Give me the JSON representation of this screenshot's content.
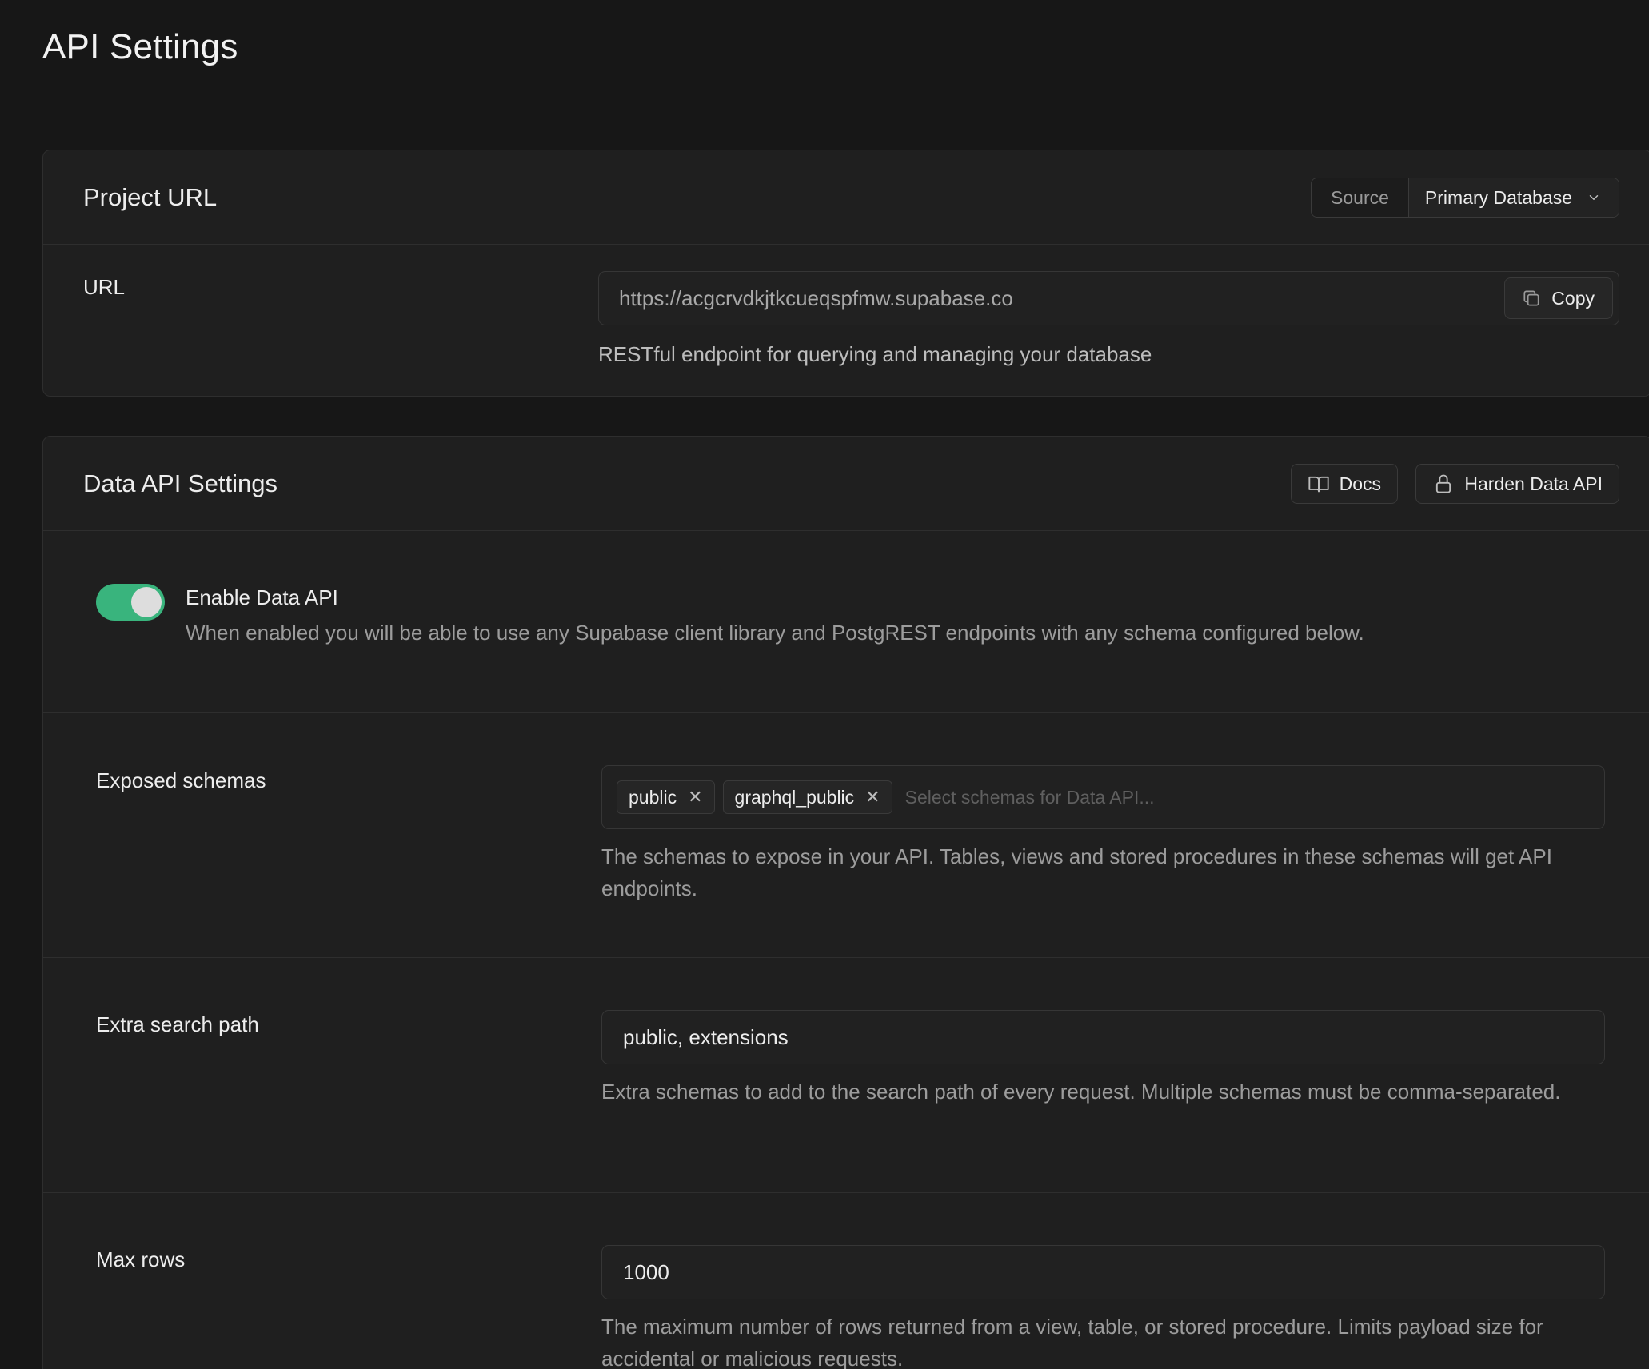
{
  "page": {
    "title": "API Settings"
  },
  "project_url": {
    "title": "Project URL",
    "source_label": "Source",
    "source_value": "Primary Database",
    "url_label": "URL",
    "url_value": "https://acgcrvdkjtkcueqspfmw.supabase.co",
    "copy_label": "Copy",
    "url_description": "RESTful endpoint for querying and managing your database"
  },
  "data_api": {
    "title": "Data API Settings",
    "docs_label": "Docs",
    "harden_label": "Harden Data API",
    "enable_label": "Enable Data API",
    "enable_description": "When enabled you will be able to use any Supabase client library and PostgREST endpoints with any schema configured below.",
    "enabled": true,
    "accent_color": "#3ecf8e",
    "exposed_schemas_label": "Exposed schemas",
    "exposed_schemas": [
      "public",
      "graphql_public"
    ],
    "exposed_schemas_placeholder": "Select schemas for Data API...",
    "exposed_schemas_description": "The schemas to expose in your API. Tables, views and stored procedures in these schemas will get API endpoints.",
    "extra_search_path_label": "Extra search path",
    "extra_search_path_value": "public, extensions",
    "extra_search_path_description": "Extra schemas to add to the search path of every request. Multiple schemas must be comma-separated.",
    "max_rows_label": "Max rows",
    "max_rows_value": "1000",
    "max_rows_description": "The maximum number of rows returned from a view, table, or stored procedure. Limits payload size for accidental or malicious requests."
  },
  "icons": {
    "source_dropdown": "chevron-down-icon",
    "copy": "copy-icon",
    "docs": "book-icon",
    "harden": "lock-icon",
    "chip_remove": "close-icon"
  }
}
